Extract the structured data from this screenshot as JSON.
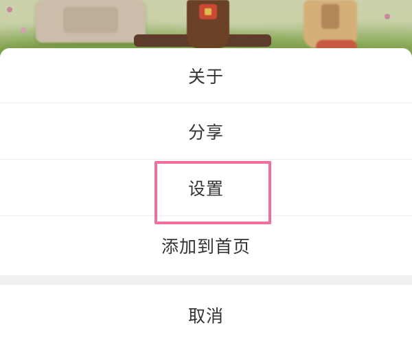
{
  "menu": {
    "items": [
      {
        "label": "关于"
      },
      {
        "label": "分享"
      },
      {
        "label": "设置"
      },
      {
        "label": "添加到首页"
      }
    ],
    "cancel_label": "取消",
    "highlighted_item": "设置"
  },
  "colors": {
    "highlight": "#f06f9f",
    "sheet_bg": "#ffffff",
    "text": "#333333"
  }
}
